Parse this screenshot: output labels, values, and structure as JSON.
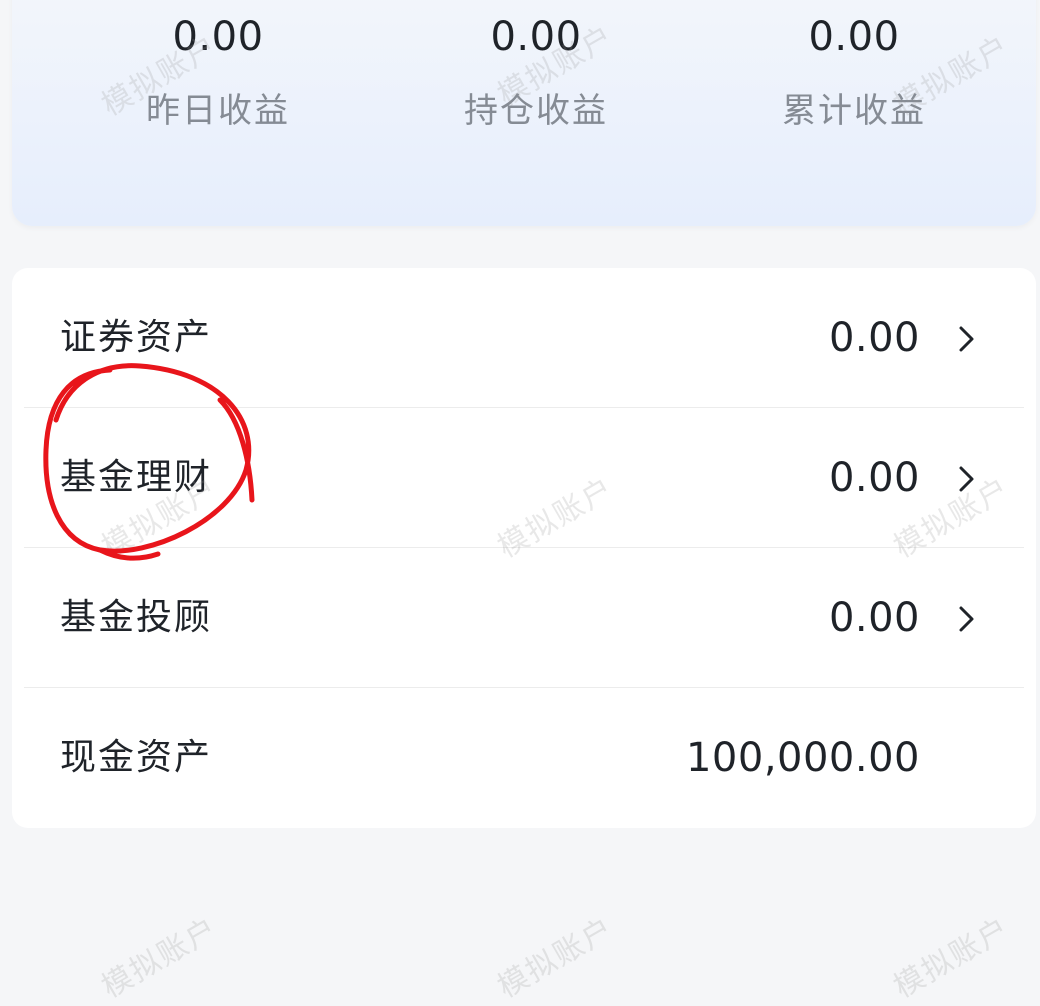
{
  "summary": {
    "stats": [
      {
        "value": "0.00",
        "label": "昨日收益"
      },
      {
        "value": "0.00",
        "label": "持仓收益"
      },
      {
        "value": "0.00",
        "label": "累计收益"
      }
    ]
  },
  "assets": {
    "rows": [
      {
        "name": "证券资产",
        "amount": "0.00",
        "has_chevron": true
      },
      {
        "name": "基金理财",
        "amount": "0.00",
        "has_chevron": true
      },
      {
        "name": "基金投顾",
        "amount": "0.00",
        "has_chevron": true
      },
      {
        "name": "现金资产",
        "amount": "100,000.00",
        "has_chevron": false
      }
    ]
  },
  "watermark": {
    "text": "模拟账户"
  },
  "icons": {
    "chevron": "chevron-right-icon"
  },
  "colors": {
    "annotation": "#e8151b",
    "text_primary": "#1f2329",
    "text_secondary": "#858b94",
    "summary_bg_top": "#f3f6fb",
    "summary_bg_bottom": "#e6eefc"
  }
}
